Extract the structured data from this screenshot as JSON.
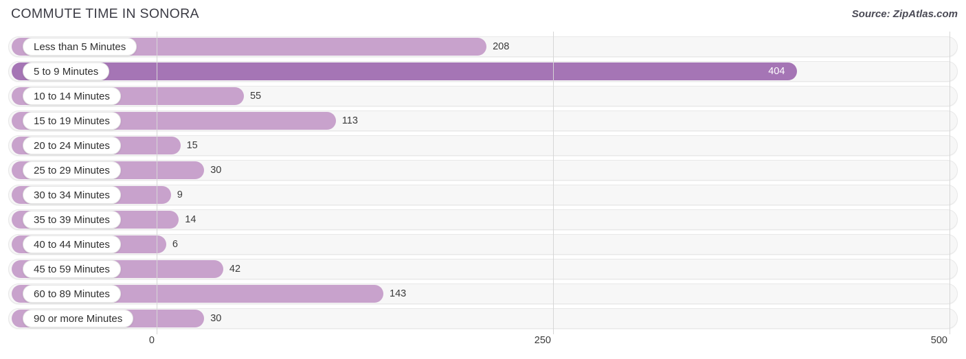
{
  "header": {
    "title": "COMMUTE TIME IN SONORA",
    "source": "Source: ZipAtlas.com"
  },
  "colors": {
    "bar_normal": "#c8a2cc",
    "bar_max": "#a575b5",
    "track": "#f7f7f7",
    "grid": "#d6d6d6",
    "label_pill": "#ffffff",
    "text": "#3a3a3a"
  },
  "chart_data": {
    "type": "bar",
    "orientation": "horizontal",
    "title": "COMMUTE TIME IN SONORA",
    "source": "Source: ZipAtlas.com",
    "xlabel": "",
    "ylabel": "",
    "xlim": [
      0,
      500
    ],
    "xticks": [
      0,
      250,
      500
    ],
    "xtick_labels": [
      "0",
      "250",
      "500"
    ],
    "grid": true,
    "legend": false,
    "categories": [
      "Less than 5 Minutes",
      "5 to 9 Minutes",
      "10 to 14 Minutes",
      "15 to 19 Minutes",
      "20 to 24 Minutes",
      "25 to 29 Minutes",
      "30 to 34 Minutes",
      "35 to 39 Minutes",
      "40 to 44 Minutes",
      "45 to 59 Minutes",
      "60 to 89 Minutes",
      "90 or more Minutes"
    ],
    "values": [
      208,
      404,
      55,
      113,
      15,
      30,
      9,
      14,
      6,
      42,
      143,
      30
    ],
    "value_labels": [
      "208",
      "404",
      "55",
      "113",
      "15",
      "30",
      "9",
      "14",
      "6",
      "42",
      "143",
      "30"
    ]
  }
}
